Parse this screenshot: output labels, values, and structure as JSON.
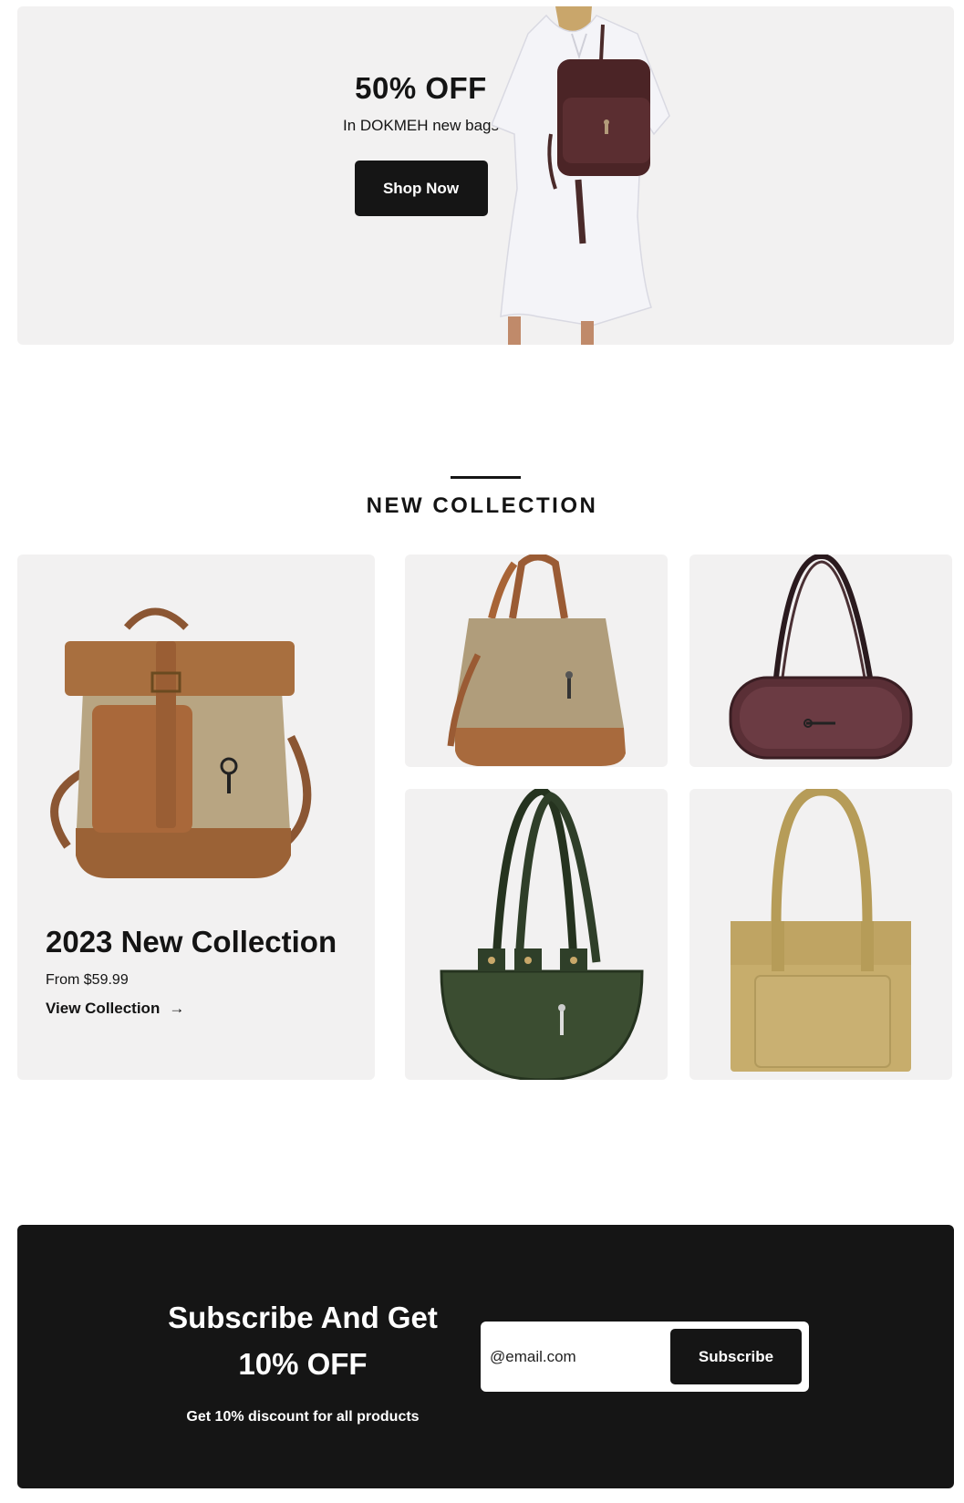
{
  "hero": {
    "title": "50% OFF",
    "subtitle": "In DOKMEH new bags",
    "cta_label": "Shop Now"
  },
  "collection": {
    "section_title": "NEW COLLECTION",
    "featured": {
      "title": "2023 New Collection",
      "price": "From $59.99",
      "link_label": "View Collection",
      "link_icon": "arrow-right-icon"
    }
  },
  "subscribe": {
    "title_line1": "Subscribe And Get",
    "title_line2": "10% OFF",
    "note": "Get 10% discount for all products",
    "email_placeholder": "@email.com",
    "button_label": "Subscribe"
  },
  "colors": {
    "card_bg": "#f2f1f1",
    "dark": "#151515",
    "white": "#ffffff"
  }
}
